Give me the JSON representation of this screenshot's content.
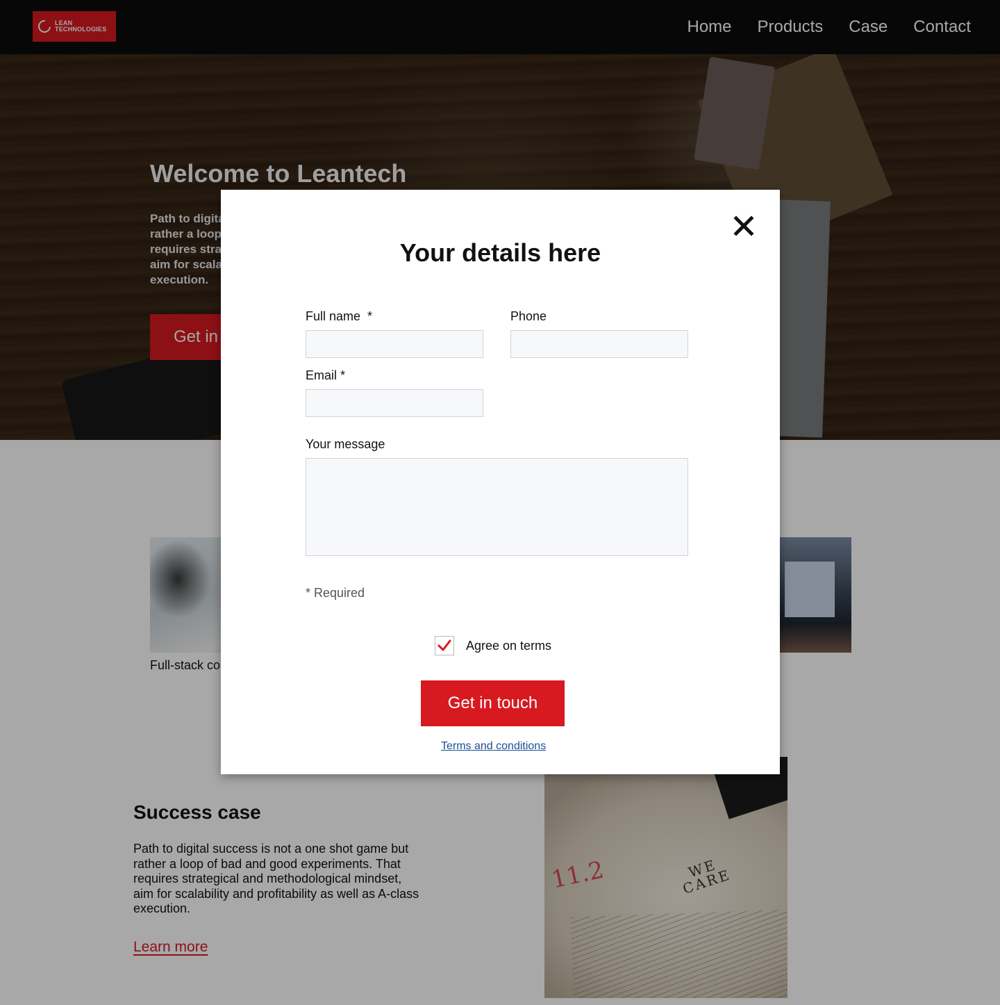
{
  "nav": {
    "logo": {
      "line1": "LEAN",
      "line2": "TECHNOLOGIES"
    },
    "links": [
      "Home",
      "Products",
      "Case",
      "Contact"
    ]
  },
  "hero": {
    "title": "Welcome to Leantech",
    "text": "Path to digital success is not a one shot game but rather a loop of bad and good experiments. That requires strategical and methodological mindset, aim for scalability and profitability as well as A-class execution.",
    "button": "Get in"
  },
  "services": {
    "caption": "Full-stack co"
  },
  "case": {
    "title": "Success case",
    "text": "Path to digital success is not a one shot game but rather a loop of bad and good experiments. That requires strategical and methodological mindset, aim for scalability and profitability as well as A-class execution.",
    "link": "Learn more",
    "image_text": {
      "number": "11.2",
      "word1": "WE",
      "word2": "CARE"
    }
  },
  "modal": {
    "title": "Your details here",
    "fields": {
      "full_name": {
        "label": "Full name  *",
        "value": ""
      },
      "phone": {
        "label": "Phone",
        "value": ""
      },
      "email": {
        "label": "Email *",
        "value": ""
      },
      "message": {
        "label": "Your message",
        "value": ""
      }
    },
    "required_note": "* Required",
    "agree": {
      "label": "Agree on terms",
      "checked": true
    },
    "submit": "Get in touch",
    "terms_link": "Terms and conditions"
  },
  "colors": {
    "accent": "#d71920",
    "nav_bg": "#0b0b0b",
    "link": "#1b4f93"
  },
  "icons": {
    "close": "close-icon",
    "check": "checkmark-icon",
    "logo": "logo-ring-icon"
  }
}
